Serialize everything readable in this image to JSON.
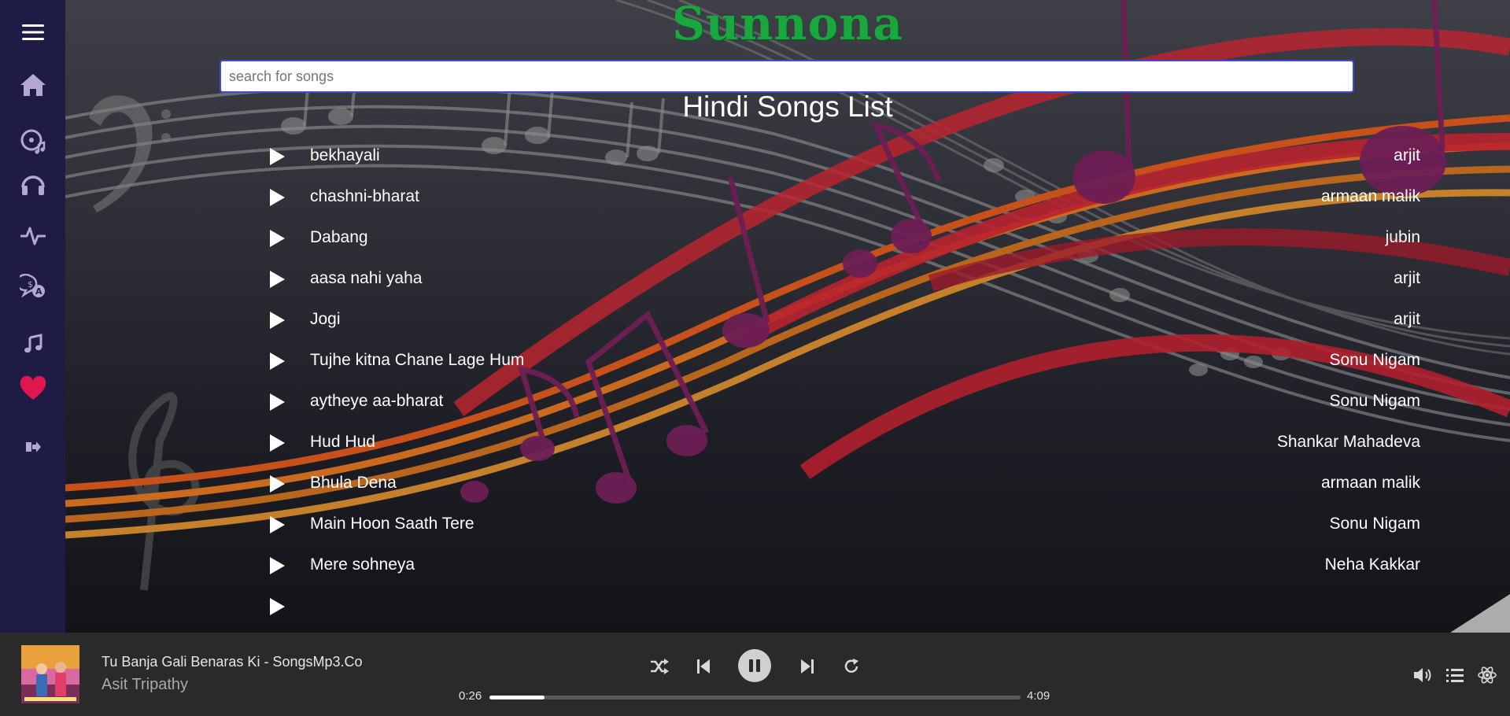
{
  "app": {
    "brand": "Sunnona"
  },
  "sidebar": {
    "items": [
      {
        "icon": "hamburger-menu-icon"
      },
      {
        "icon": "home-icon"
      },
      {
        "icon": "music-disc-icon"
      },
      {
        "icon": "headphones-icon"
      },
      {
        "icon": "pulse-icon"
      },
      {
        "icon": "language-chat-icon"
      },
      {
        "icon": "music-note-icon"
      },
      {
        "icon": "heart-icon"
      },
      {
        "icon": "logout-icon"
      }
    ],
    "colors": {
      "bg": "#1e1b45",
      "icon": "#b4a6d6",
      "heart": "#e0164f"
    }
  },
  "search": {
    "placeholder": "search for songs",
    "value": ""
  },
  "list": {
    "title": "Hindi Songs List",
    "songs": [
      {
        "title": "bekhayali",
        "artist": "arjit"
      },
      {
        "title": "chashni-bharat",
        "artist": "armaan malik"
      },
      {
        "title": "Dabang",
        "artist": "jubin"
      },
      {
        "title": "aasa nahi yaha",
        "artist": "arjit"
      },
      {
        "title": "Jogi",
        "artist": "arjit"
      },
      {
        "title": "Tujhe kitna Chane Lage Hum",
        "artist": "Sonu Nigam"
      },
      {
        "title": "aytheye aa-bharat",
        "artist": "Sonu Nigam"
      },
      {
        "title": "Hud Hud",
        "artist": "Shankar Mahadeva"
      },
      {
        "title": "Bhula Dena",
        "artist": "armaan malik"
      },
      {
        "title": "Main Hoon Saath Tere",
        "artist": "Sonu Nigam"
      },
      {
        "title": "Mere sohneya",
        "artist": "Neha Kakkar"
      }
    ]
  },
  "player": {
    "now_playing": {
      "title": "Tu Banja Gali Benaras Ki - SongsMp3.Co",
      "artist": "Asit Tripathy"
    },
    "current_time": "0:26",
    "duration": "4:09",
    "progress": 0.104,
    "controls": [
      "shuffle-icon",
      "previous-icon",
      "pause-icon",
      "next-icon",
      "repeat-icon"
    ],
    "right_controls": [
      "volume-icon",
      "queue-list-icon",
      "react-atom-icon"
    ]
  }
}
